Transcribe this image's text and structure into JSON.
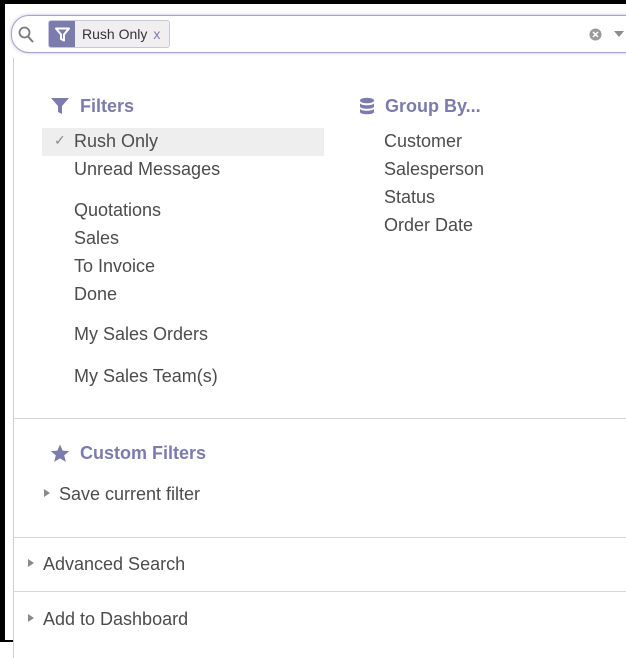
{
  "search": {
    "facet_label": "Rush Only",
    "facet_remove": "x"
  },
  "filters": {
    "title": "Filters",
    "items": [
      "Rush Only",
      "Unread Messages",
      "Quotations",
      "Sales",
      "To Invoice",
      "Done",
      "My Sales Orders",
      "My Sales Team(s)"
    ],
    "check": "✓"
  },
  "group_by": {
    "title": "Group By...",
    "items": [
      "Customer",
      "Salesperson",
      "Status",
      "Order Date"
    ]
  },
  "custom_filters": {
    "title": "Custom Filters",
    "save_label": "Save current filter"
  },
  "advanced_search": {
    "label": "Advanced Search"
  },
  "add_to_dashboard": {
    "label": "Add to Dashboard"
  },
  "colors": {
    "accent": "#7c7bad",
    "text": "#4c4c4c",
    "selected_bg": "#eeeeee"
  }
}
